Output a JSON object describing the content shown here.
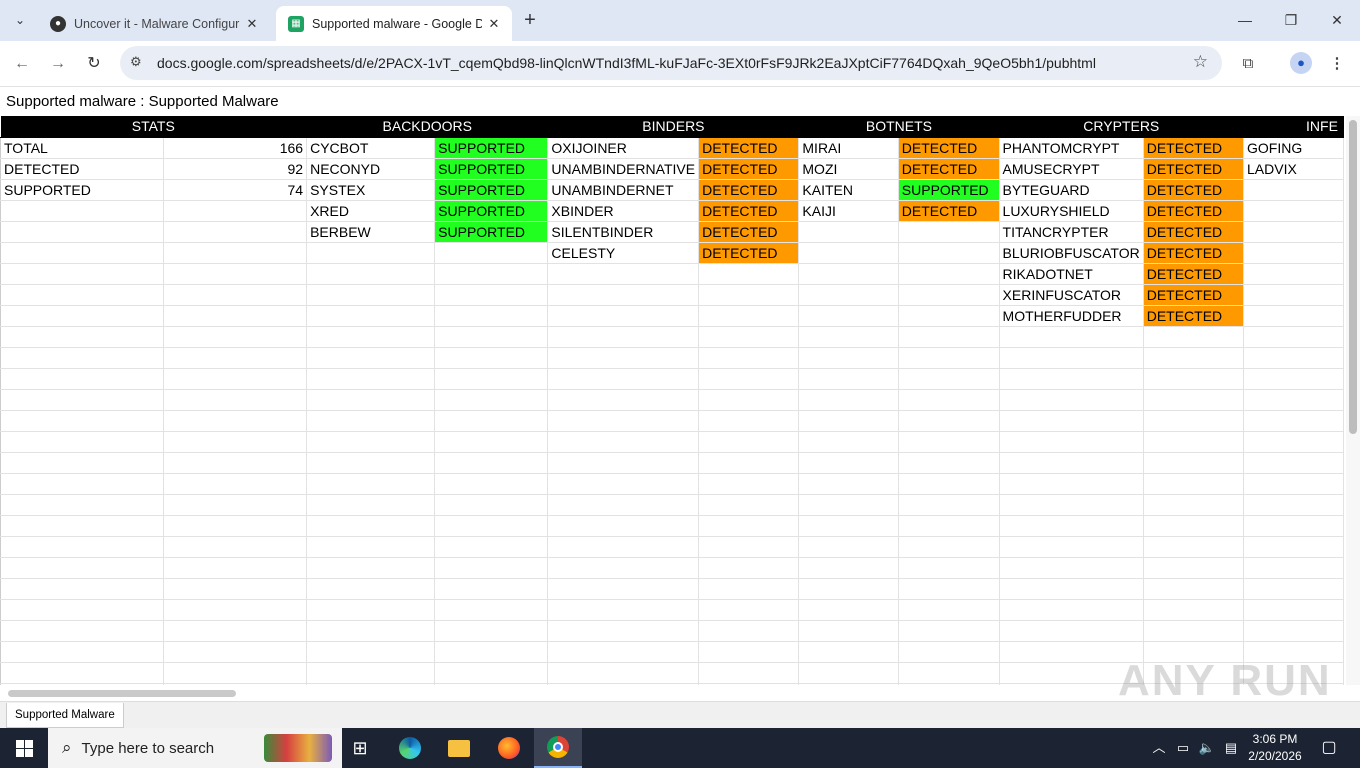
{
  "browser": {
    "tabs": [
      {
        "title": "Uncover it - Malware Configura",
        "icon": "shield-icon",
        "active": false
      },
      {
        "title": "Supported malware - Google D",
        "icon": "sheets-icon",
        "active": true
      }
    ],
    "url": "docs.google.com/spreadsheets/d/e/2PACX-1vT_cqemQbd98-linQlcnWTndI3fML-kuFJaFc-3EXt0rFsF9JRk2EaJXptCiF7764DQxah_9QeO5bh1/pubhtml"
  },
  "doc": {
    "title": "Supported malware : Supported Malware"
  },
  "sheet": {
    "headers": [
      "STATS",
      "BACKDOORS",
      "BINDERS",
      "BOTNETS",
      "CRYPTERS",
      "INFE"
    ],
    "stats": [
      {
        "label": "TOTAL",
        "value": "166"
      },
      {
        "label": "DETECTED",
        "value": "92"
      },
      {
        "label": "SUPPORTED",
        "value": "74"
      }
    ],
    "backdoors": [
      {
        "name": "CYCBOT",
        "status": "SUPPORTED"
      },
      {
        "name": "NECONYD",
        "status": "SUPPORTED"
      },
      {
        "name": "SYSTEX",
        "status": "SUPPORTED"
      },
      {
        "name": "XRED",
        "status": "SUPPORTED"
      },
      {
        "name": "BERBEW",
        "status": "SUPPORTED"
      }
    ],
    "binders": [
      {
        "name": "OXIJOINER",
        "status": "DETECTED"
      },
      {
        "name": "UNAMBINDERNATIVE",
        "status": "DETECTED"
      },
      {
        "name": "UNAMBINDERNET",
        "status": "DETECTED"
      },
      {
        "name": "XBINDER",
        "status": "DETECTED"
      },
      {
        "name": "SILENTBINDER",
        "status": "DETECTED"
      },
      {
        "name": "CELESTY",
        "status": "DETECTED"
      }
    ],
    "botnets": [
      {
        "name": "MIRAI",
        "status": "DETECTED"
      },
      {
        "name": "MOZI",
        "status": "DETECTED"
      },
      {
        "name": "KAITEN",
        "status": "SUPPORTED"
      },
      {
        "name": "KAIJI",
        "status": "DETECTED"
      }
    ],
    "crypters": [
      {
        "name": "PHANTOMCRYPT",
        "status": "DETECTED"
      },
      {
        "name": "AMUSECRYPT",
        "status": "DETECTED"
      },
      {
        "name": "BYTEGUARD",
        "status": "DETECTED"
      },
      {
        "name": "LUXURYSHIELD",
        "status": "DETECTED"
      },
      {
        "name": "TITANCRYPTER",
        "status": "DETECTED"
      },
      {
        "name": "BLURIOBFUSCATOR",
        "status": "DETECTED"
      },
      {
        "name": "RIKADOTNET",
        "status": "DETECTED"
      },
      {
        "name": "XERINFUSCATOR",
        "status": "DETECTED"
      },
      {
        "name": "MOTHERFUDDER",
        "status": "DETECTED"
      }
    ],
    "infectors": [
      {
        "name": "GOFING"
      },
      {
        "name": "LADVIX"
      }
    ],
    "colors": {
      "supported": "#20ff20",
      "detected": "#ff9900",
      "header_bg": "#000000"
    },
    "sheet_tab": "Supported Malware"
  },
  "watermark": "ANY RUN",
  "taskbar": {
    "search_placeholder": "Type here to search",
    "time": "3:06 PM",
    "date": "2/20/2026"
  }
}
